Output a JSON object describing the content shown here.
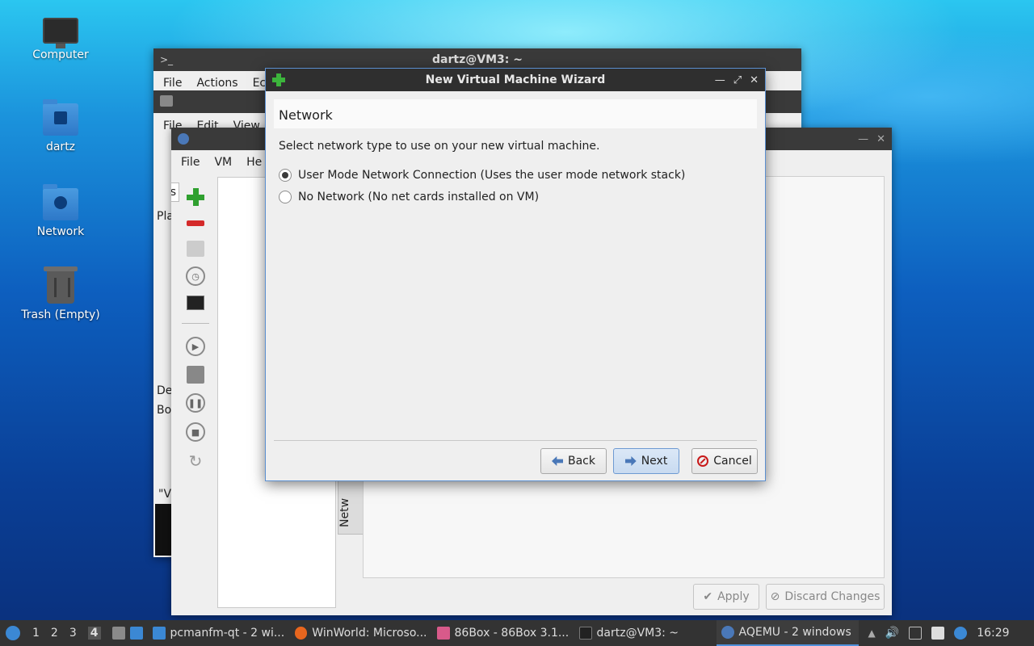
{
  "desktop": {
    "icons": [
      {
        "label": "Computer"
      },
      {
        "label": "dartz"
      },
      {
        "label": "Network"
      },
      {
        "label": "Trash (Empty)"
      }
    ]
  },
  "terminal": {
    "title": "dartz@VM3: ~",
    "menu": [
      "File",
      "Actions",
      "Ec"
    ]
  },
  "filemanager": {
    "menu": [
      "File",
      "Edit",
      "View"
    ],
    "left_labels": [
      "Lis",
      "Pla",
      "De",
      "Bo",
      "\"V"
    ]
  },
  "aqemu": {
    "menu": [
      "File",
      "VM",
      "He"
    ],
    "tab_label": "Netw",
    "buttons": {
      "apply": "Apply",
      "discard": "Discard Changes"
    }
  },
  "wizard": {
    "title": "New Virtual Machine Wizard",
    "heading": "Network",
    "description": "Select network type to use on your new virtual machine.",
    "options": [
      {
        "label": "User Mode Network Connection (Uses the user mode network stack)",
        "selected": true
      },
      {
        "label": "No Network (No net cards installed on VM)",
        "selected": false
      }
    ],
    "buttons": {
      "back": "Back",
      "next": "Next",
      "cancel": "Cancel"
    }
  },
  "taskbar": {
    "workspaces": [
      "1",
      "2",
      "3",
      "4"
    ],
    "tasks": [
      {
        "label": "pcmanfm-qt - 2 wi..."
      },
      {
        "label": "WinWorld: Microso..."
      },
      {
        "label": "86Box - 86Box 3.1..."
      },
      {
        "label": "dartz@VM3: ~"
      },
      {
        "label": "AQEMU - 2 windows"
      }
    ],
    "clock": "16:29"
  }
}
